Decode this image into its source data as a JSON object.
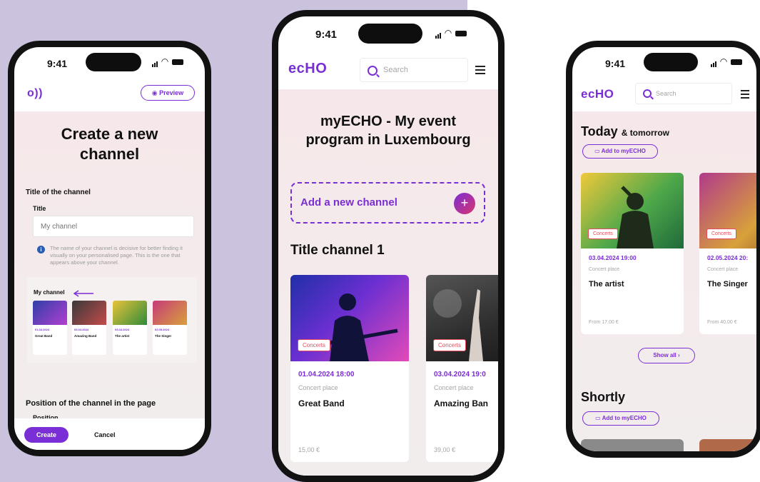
{
  "status": {
    "time": "9:41"
  },
  "phone1": {
    "preview_label": "Preview",
    "page_title_line1": "Create a new",
    "page_title_line2": "channel",
    "section_title": "Title of the channel",
    "title_label": "Title",
    "title_placeholder": "My channel",
    "help_text": "The name of your channel is decisive for better finding it visually on your personalised page. This is the one that appears above your channel.",
    "preview_heading": "My channel",
    "position_heading": "Position of the channel in the page",
    "position_label": "Position",
    "create_label": "Create",
    "cancel_label": "Cancel"
  },
  "phone2": {
    "logo": "ecHO",
    "search_placeholder": "Search",
    "title_line1": "myECHO - My event",
    "title_line2": "program in Luxembourg",
    "add_channel_label": "Add a new channel",
    "channel_title": "Title channel 1",
    "cards": [
      {
        "tag": "Concerts",
        "date": "01.04.2024  18:00",
        "place": "Concert place",
        "name": "Great Band",
        "price": "15,00 €"
      },
      {
        "tag": "Concerts",
        "date": "03.04.2024  19:0",
        "place": "Concert place",
        "name": "Amazing Ban",
        "price": "39,00 €"
      }
    ]
  },
  "phone3": {
    "logo": "ecHO",
    "search_placeholder": "Search",
    "today_heading": "Today",
    "today_suffix": "& tomorrow",
    "add_to_label": "Add to myECHO",
    "cards": [
      {
        "tag": "Concerts",
        "date": "03.04.2024  19:00",
        "place": "Concert place",
        "name": "The artist",
        "price": "From 17,00 €"
      },
      {
        "tag": "Concerts",
        "date": "02.05.2024  20:",
        "place": "Concert place",
        "name": "The Singer",
        "price": "From 40,00 €"
      }
    ],
    "show_all_label": "Show all",
    "shortly_heading": "Shortly",
    "add_to_label_2": "Add to myECHO"
  },
  "colors": {
    "accent": "#7a2ed6",
    "tag": "#e54b5a",
    "backdrop": "#cbc3dd"
  }
}
